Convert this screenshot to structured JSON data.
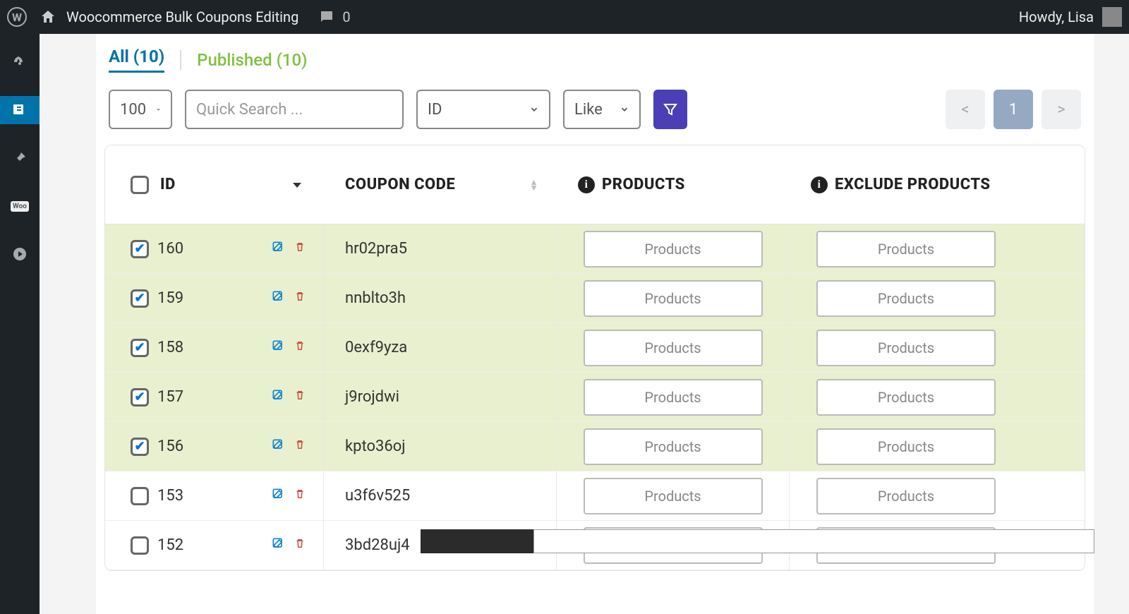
{
  "adminbar": {
    "site_title": "Woocommerce Bulk Coupons Editing",
    "comment_count": "0",
    "howdy": "Howdy, Lisa"
  },
  "tabs": {
    "all": "All (10)",
    "published": "Published (10)"
  },
  "filters": {
    "per_page": "100",
    "search_placeholder": "Quick Search ...",
    "field": "ID",
    "operator": "Like"
  },
  "pagination": {
    "prev": "<",
    "current": "1",
    "next": ">"
  },
  "columns": {
    "id": "ID",
    "code": "COUPON CODE",
    "products": "PRODUCTS",
    "exclude": "EXCLUDE PRODUCTS"
  },
  "buttons": {
    "products": "Products"
  },
  "rows": [
    {
      "id": "160",
      "code": "hr02pra5",
      "checked": true
    },
    {
      "id": "159",
      "code": "nnblto3h",
      "checked": true
    },
    {
      "id": "158",
      "code": "0exf9yza",
      "checked": true
    },
    {
      "id": "157",
      "code": "j9rojdwi",
      "checked": true
    },
    {
      "id": "156",
      "code": "kpto36oj",
      "checked": true
    },
    {
      "id": "153",
      "code": "u3f6v525",
      "checked": false
    },
    {
      "id": "152",
      "code": "3bd28uj4",
      "checked": false
    }
  ]
}
